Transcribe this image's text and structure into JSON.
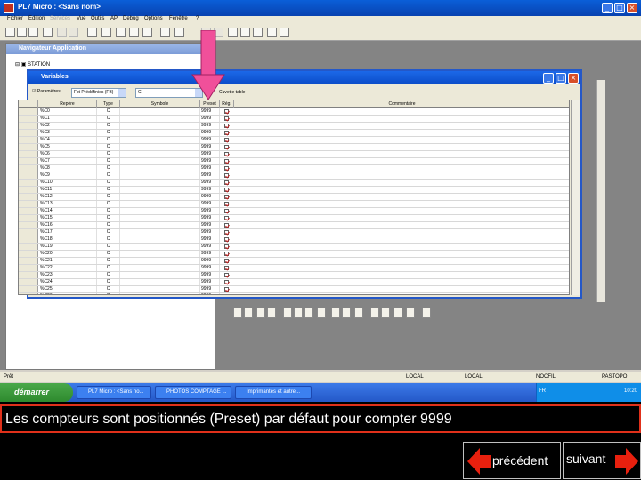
{
  "app": {
    "title": "PL7 Micro : <Sans nom>",
    "menu": [
      "Fichier",
      "Edition",
      "Services",
      "Vue",
      "Outils",
      "AP",
      "Debug",
      "Options",
      "Fenêtre",
      "?"
    ]
  },
  "navigator": {
    "title": "Navigateur Application",
    "tree_root": "STATION"
  },
  "variables_window": {
    "title": "Variables",
    "filter_checkbox_label": "Paramètres",
    "filter_type": "Fct Prédéfinies (FB)",
    "filter_subtype": "C",
    "filter_extra": "Cuvette table",
    "columns": [
      "Repère",
      "Type",
      "Symbole",
      "Preset",
      "Rég.",
      "Commentaire"
    ],
    "rows": [
      {
        "repere": "%C0",
        "type": "C",
        "preset": "9999"
      },
      {
        "repere": "%C1",
        "type": "C",
        "preset": "9999"
      },
      {
        "repere": "%C2",
        "type": "C",
        "preset": "9999"
      },
      {
        "repere": "%C3",
        "type": "C",
        "preset": "9999"
      },
      {
        "repere": "%C4",
        "type": "C",
        "preset": "9999"
      },
      {
        "repere": "%C5",
        "type": "C",
        "preset": "9999"
      },
      {
        "repere": "%C6",
        "type": "C",
        "preset": "9999"
      },
      {
        "repere": "%C7",
        "type": "C",
        "preset": "9999"
      },
      {
        "repere": "%C8",
        "type": "C",
        "preset": "9999"
      },
      {
        "repere": "%C9",
        "type": "C",
        "preset": "9999"
      },
      {
        "repere": "%C10",
        "type": "C",
        "preset": "9999"
      },
      {
        "repere": "%C11",
        "type": "C",
        "preset": "9999"
      },
      {
        "repere": "%C12",
        "type": "C",
        "preset": "9999"
      },
      {
        "repere": "%C13",
        "type": "C",
        "preset": "9999"
      },
      {
        "repere": "%C14",
        "type": "C",
        "preset": "9999"
      },
      {
        "repere": "%C15",
        "type": "C",
        "preset": "9999"
      },
      {
        "repere": "%C16",
        "type": "C",
        "preset": "9999"
      },
      {
        "repere": "%C17",
        "type": "C",
        "preset": "9999"
      },
      {
        "repere": "%C18",
        "type": "C",
        "preset": "9999"
      },
      {
        "repere": "%C19",
        "type": "C",
        "preset": "9999"
      },
      {
        "repere": "%C20",
        "type": "C",
        "preset": "9999"
      },
      {
        "repere": "%C21",
        "type": "C",
        "preset": "9999"
      },
      {
        "repere": "%C22",
        "type": "C",
        "preset": "9999"
      },
      {
        "repere": "%C23",
        "type": "C",
        "preset": "9999"
      },
      {
        "repere": "%C24",
        "type": "C",
        "preset": "9999"
      },
      {
        "repere": "%C25",
        "type": "C",
        "preset": "9999"
      },
      {
        "repere": "%C26",
        "type": "C",
        "preset": "9999"
      }
    ]
  },
  "status_bar": {
    "left": "Prêt",
    "seg1": "LOCAL",
    "seg2": "LOCAL",
    "seg3": "NOCFIL",
    "seg4": "PASTOPO"
  },
  "taskbar": {
    "start_label": "démarrer",
    "tasks": [
      "PL7 Micro : <Sans no...",
      "PHOTOS COMPTAGE ...",
      "Imprimantes et autre..."
    ],
    "tray_lang": "FR",
    "clock": "10:20"
  },
  "caption": "Les compteurs sont positionnés (Preset) par défaut pour compter 9999",
  "nav": {
    "prev_label": "précédent",
    "next_label": "suivant"
  },
  "colors": {
    "arrow_pink": "#f0509a",
    "nav_arrow_red": "#e8200e",
    "caption_border": "#e0301a"
  }
}
